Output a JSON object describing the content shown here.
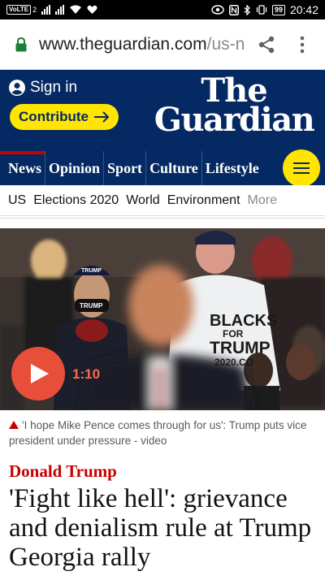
{
  "status_bar": {
    "volte": "VoLTE",
    "sim_label": "2",
    "battery": "99",
    "time": "20:42"
  },
  "browser": {
    "url_main": "www.theguardian.com",
    "url_dim": "/us-n"
  },
  "header": {
    "sign_in": "Sign in",
    "contribute": "Contribute",
    "logo_line1": "The",
    "logo_line2": "Guardian",
    "brand_color": "#052962",
    "accent_yellow": "#ffe500"
  },
  "nav": {
    "items": [
      "News",
      "Opinion",
      "Sport",
      "Culture",
      "Lifestyle"
    ],
    "active_index": 0
  },
  "subnav": {
    "items": [
      "US",
      "Elections 2020",
      "World",
      "Environment"
    ],
    "more": "More"
  },
  "video": {
    "sign_text_1": "BLACKS",
    "sign_text_2": "FOR",
    "sign_text_3": "TRUMP",
    "sign_text_4": "2020.CO",
    "hat_text": "TRUMP",
    "mask_text": "TRUMP",
    "duration": "1:10"
  },
  "caption": {
    "text": "'I hope Mike Pence comes through for us': Trump puts vice president under pressure - video"
  },
  "article": {
    "kicker": "Donald Trump",
    "headline": "'Fight like hell': grievance and denialism rule at Trump Georgia rally",
    "kicker_color": "#c70000"
  }
}
